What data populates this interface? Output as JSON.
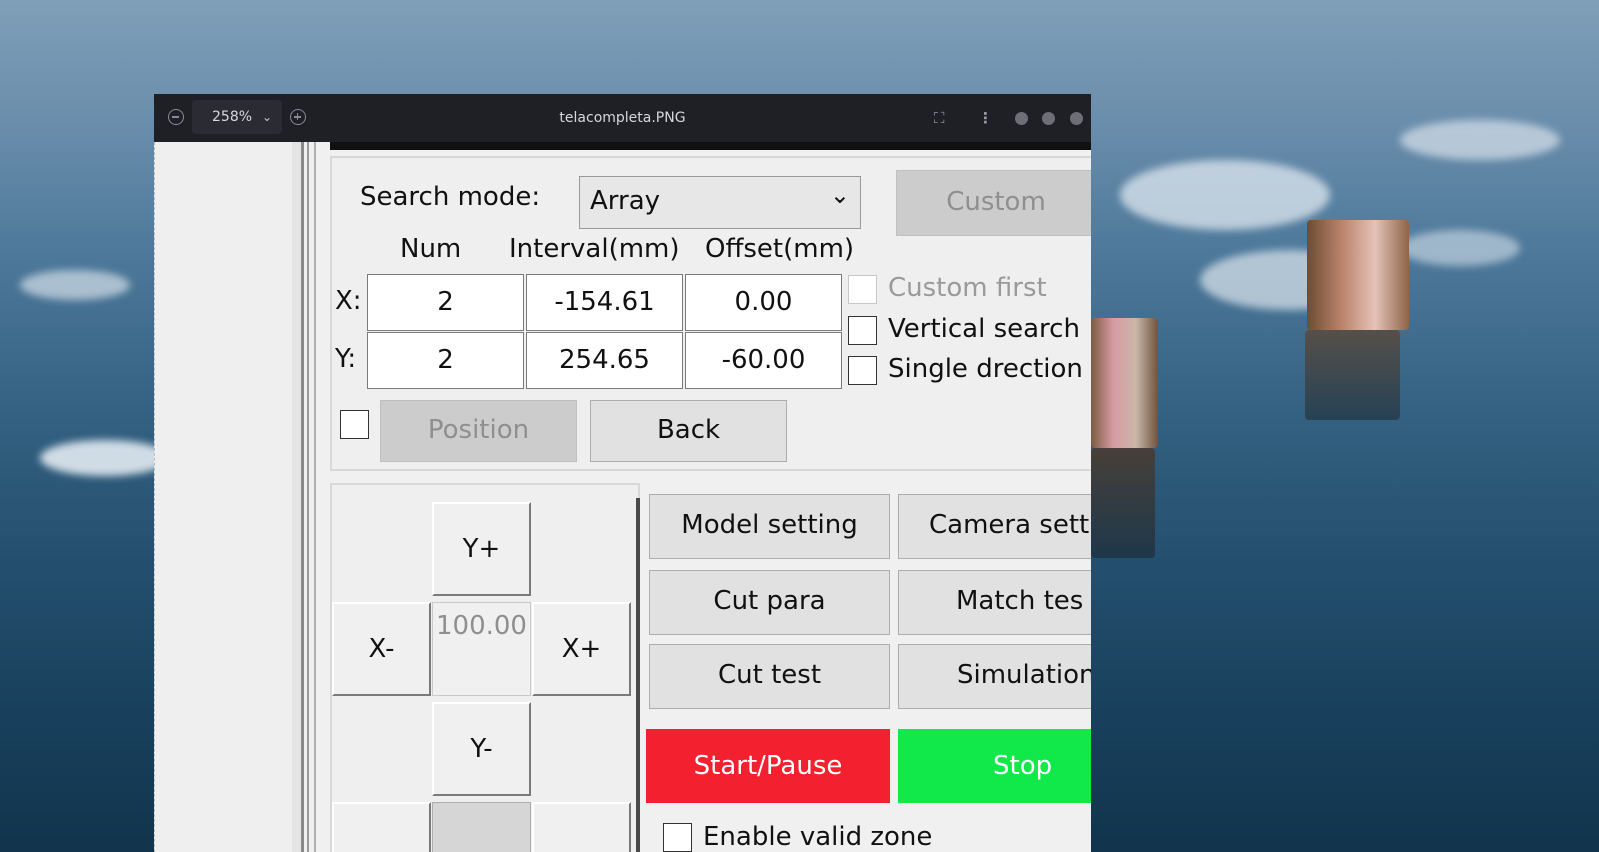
{
  "viewer": {
    "zoom": "258%",
    "file_title": "telacompleta.PNG"
  },
  "search": {
    "mode_label": "Search mode:",
    "mode_value": "Array",
    "custom_button": "Custom",
    "col_num": "Num",
    "col_interval": "Interval(mm)",
    "col_offset": "Offset(mm)",
    "x_label": "X:",
    "y_label": "Y:",
    "x_num": "2",
    "x_interval": "-154.61",
    "x_offset": "0.00",
    "y_num": "2",
    "y_interval": "254.65",
    "y_offset": "-60.00",
    "custom_first": "Custom first",
    "vertical_search": "Vertical search",
    "single_direction": "Single drection",
    "position_button": "Position",
    "back_button": "Back"
  },
  "jog": {
    "y_plus": "Y+",
    "y_minus": "Y-",
    "x_minus": "X-",
    "x_plus": "X+",
    "step": "100.00"
  },
  "actions": {
    "model_setting": "Model setting",
    "camera_setting": "Camera setti",
    "cut_para": "Cut para",
    "match_test": "Match tes",
    "cut_test": "Cut test",
    "simulation": "Simulation",
    "start_pause": "Start/Pause",
    "stop": "Stop",
    "enable_valid_zone": "Enable valid zone"
  },
  "colors": {
    "start_pause_bg": "#f3202f",
    "stop_bg": "#11e94a",
    "titlebar_bg": "#1f1f26"
  }
}
